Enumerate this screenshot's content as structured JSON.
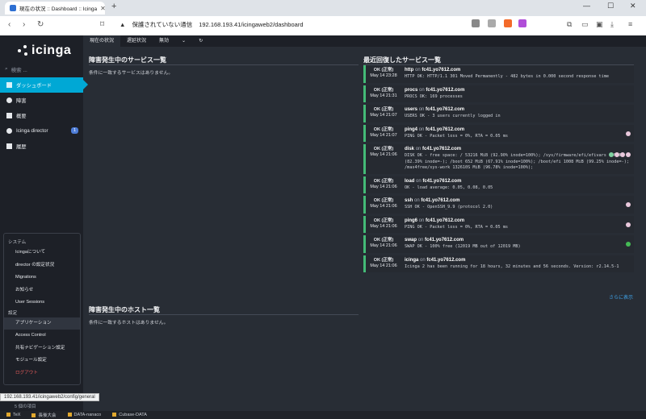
{
  "browser": {
    "tab_title": "現在の状況 :: Dashboard :: Icinga",
    "security_warning": "保護されていない通信",
    "url": "192.168.193.41/icingaweb2/dashboard",
    "status_url": "192.168.193.41/icingaweb2/config/general"
  },
  "sidebar": {
    "logo": "icinga",
    "search_placeholder": "検索 ...",
    "items": [
      {
        "label": "ダッシュボード",
        "icon": "dashboard-icon"
      },
      {
        "label": "障害",
        "icon": "alert-icon"
      },
      {
        "label": "概要",
        "icon": "binoculars-icon"
      },
      {
        "label": "Icinga director",
        "icon": "director-icon",
        "badge": "1"
      },
      {
        "label": "履歴",
        "icon": "history-icon"
      }
    ],
    "bottom_label": "5 個の項目"
  },
  "flyout": {
    "system_header": "システム",
    "system_items": [
      "Icingaについて",
      "director の設定状況",
      "Migrations",
      "お知らせ",
      "User Sessions"
    ],
    "config_header": "設定",
    "config_items": [
      "アプリケーション",
      "Access Control",
      "共有ナビゲーション設定",
      "モジュール設定"
    ],
    "logout": "ログアウト"
  },
  "tabs": [
    "現在の状況",
    "遅延状況",
    "無効"
  ],
  "left": {
    "services_title": "障害発生中のサービス一覧",
    "services_empty": "条件に一致するサービスはありません。",
    "hosts_title": "障害発生中のホスト一覧",
    "hosts_empty": "条件に一致するホストはありません。"
  },
  "right": {
    "title": "最近回復したサービス一覧",
    "more": "さらに表示",
    "on": "on",
    "rows": [
      {
        "state": "OK (正常)",
        "time": "May 14 23:28",
        "service": "http",
        "host": "fc41.yo7612.com",
        "output": "HTTP OK: HTTP/1.1 301 Moved Permanently - 482 bytes in 0.000 second response time",
        "dot": ""
      },
      {
        "state": "OK (正常)",
        "time": "May 14 21:31",
        "service": "procs",
        "host": "fc41.yo7612.com",
        "output": "PROCS OK: 169 processes",
        "dot": ""
      },
      {
        "state": "OK (正常)",
        "time": "May 14 21:07",
        "service": "users",
        "host": "fc41.yo7612.com",
        "output": "USERS OK - 3 users currently logged in",
        "dot": ""
      },
      {
        "state": "OK (正常)",
        "time": "May 14 21:07",
        "service": "ping4",
        "host": "fc41.yo7612.com",
        "output": "PING OK - Packet loss = 0%, RTA = 0.05 ms",
        "dot": "#e9c8dc"
      },
      {
        "state": "OK (正常)",
        "time": "May 14 21:06",
        "service": "disk",
        "host": "fc41.yo7612.com",
        "output": "DISK OK - free space: / 53216 MiB (92.90% inode=100%); /sys/firmware/efi/efivars 0 MiB (82.39% inode=-); /boot 652 MiB (67.91% inode=100%); /boot/efi 1008 MiB (99.25% inode=-); /mas4free/sys-work 132610S MiB (96.78% inode=100%);",
        "dot": "multi"
      },
      {
        "state": "OK (正常)",
        "time": "May 14 21:06",
        "service": "load",
        "host": "fc41.yo7612.com",
        "output": "OK - load average: 0.05, 0.08, 0.05",
        "dot": ""
      },
      {
        "state": "OK (正常)",
        "time": "May 14 21:06",
        "service": "ssh",
        "host": "fc41.yo7612.com",
        "output": "SSH OK - OpenSSH_9.9 (protocol 2.0)",
        "dot": "#e9c8dc"
      },
      {
        "state": "OK (正常)",
        "time": "May 14 21:06",
        "service": "ping6",
        "host": "fc41.yo7612.com",
        "output": "PING OK - Packet loss = 0%, RTA = 0.05 ms",
        "dot": "#e9c8dc"
      },
      {
        "state": "OK (正常)",
        "time": "May 14 21:06",
        "service": "swap",
        "host": "fc41.yo7612.com",
        "output": "SWAP OK - 100% free (12019 MB out of 12019 MB)",
        "dot": "#44bb55"
      },
      {
        "state": "OK (正常)",
        "time": "May 14 21:06",
        "service": "icinga",
        "host": "fc41.yo7612.com",
        "output": "Icinga 2 has been running for 18 hours, 32 minutes and 56 seconds. Version: r2.14.5-1",
        "dot": ""
      }
    ]
  },
  "taskbar": [
    "TeX",
    "長後大会",
    "DATA-nanaco",
    "Cubase-DATA"
  ],
  "colors": {
    "accent": "#00a8d5",
    "ok": "#44bb77",
    "link": "#3fa3ea",
    "logout": "#e35a5a"
  }
}
